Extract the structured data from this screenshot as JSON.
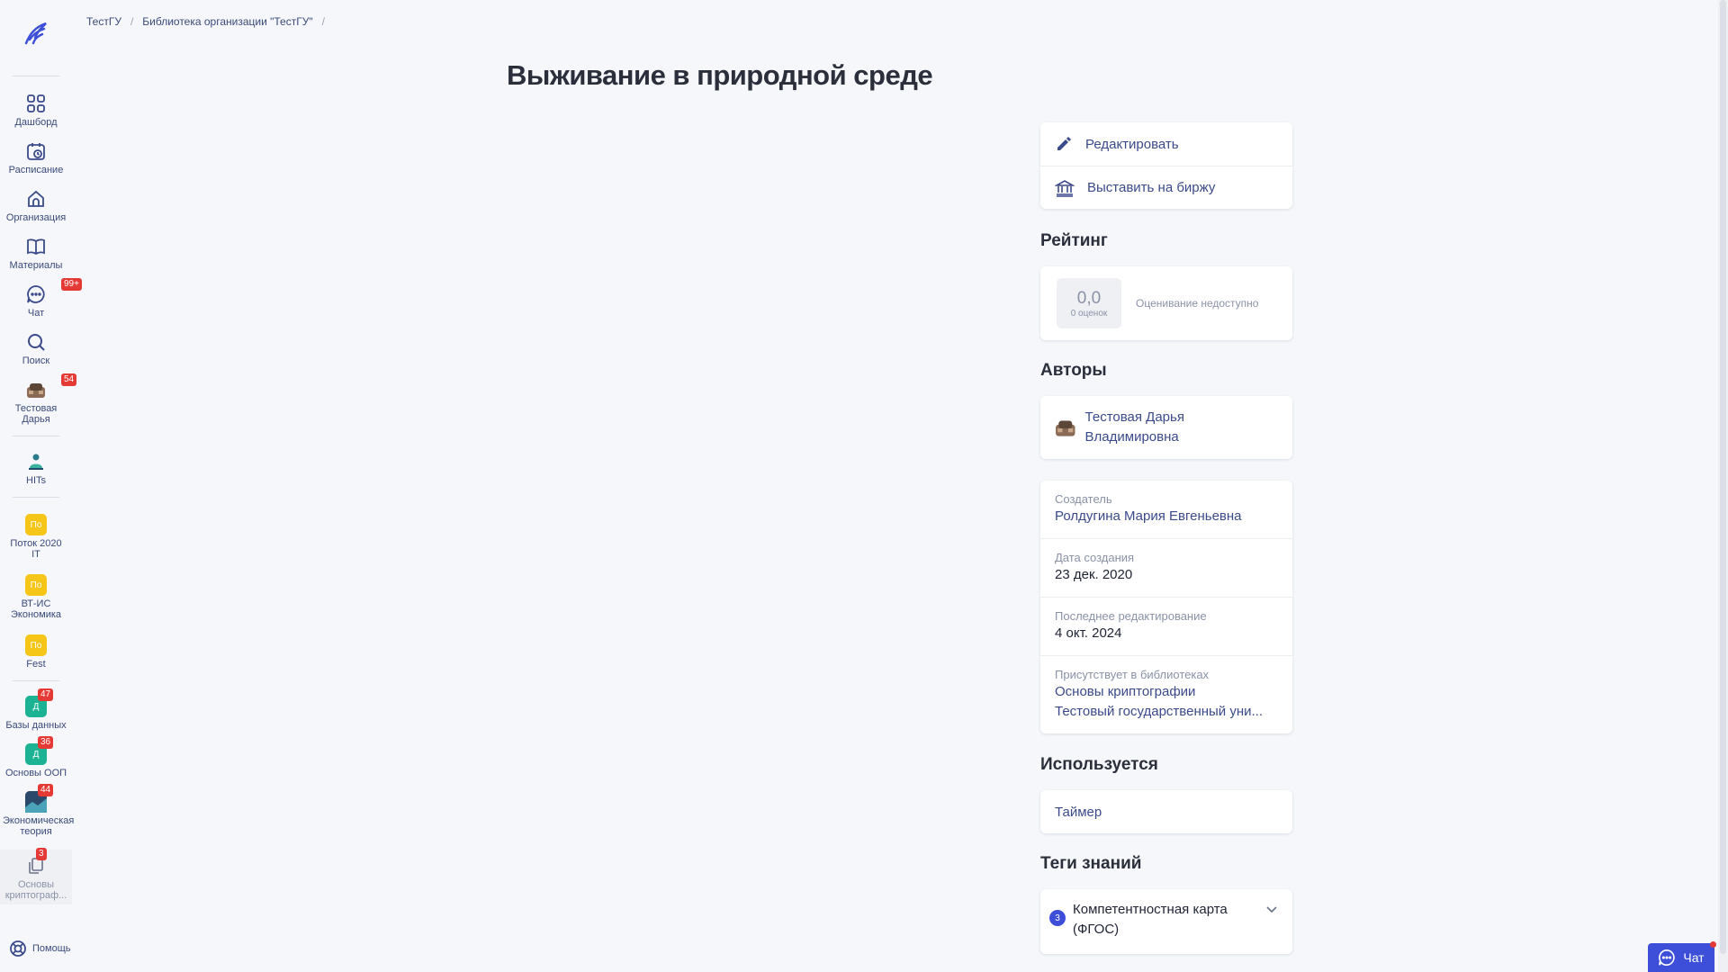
{
  "sidebar": {
    "items": [
      {
        "label": "Дашборд",
        "icon": "dashboard-icon"
      },
      {
        "label": "Расписание",
        "icon": "calendar-icon"
      },
      {
        "label": "Организация",
        "icon": "organization-icon"
      },
      {
        "label": "Материалы",
        "icon": "book-icon"
      },
      {
        "label": "Чат",
        "icon": "chat-icon",
        "badge": "99+"
      },
      {
        "label": "Поиск",
        "icon": "search-icon"
      },
      {
        "label": "Тестовая Дарья",
        "icon": "avatar",
        "badge": "54"
      }
    ],
    "hits": {
      "label": "HITs"
    },
    "streams": [
      {
        "abbr": "По",
        "label": "Поток 2020 IT"
      },
      {
        "abbr": "По",
        "label": "ВТ-ИС Экономика"
      },
      {
        "abbr": "По",
        "label": "Fest"
      }
    ],
    "courses": [
      {
        "abbr": "Д",
        "label": "Базы данных",
        "badge": "47"
      },
      {
        "abbr": "Д",
        "label": "Основы ООП",
        "badge": "36"
      },
      {
        "abbr": "",
        "label": "Экономическая теория",
        "badge": "44"
      },
      {
        "abbr": "",
        "label": "Основы криптограф...",
        "badge": "3"
      }
    ],
    "help_label": "Помощь"
  },
  "breadcrumb": [
    "ТестГУ",
    "Библиотека организации \"ТестГУ\""
  ],
  "title": "Выживание в природной среде",
  "actions": {
    "edit": "Редактировать",
    "exchange": "Выставить на биржу"
  },
  "rating": {
    "section": "Рейтинг",
    "value": "0,0",
    "count": "0 оценок",
    "note": "Оценивание недоступно"
  },
  "authors": {
    "section": "Авторы",
    "name": "Тестовая Дарья Владимировна"
  },
  "info": {
    "creator_label": "Создатель",
    "creator": "Ролдугина Мария Евгеньевна",
    "created_label": "Дата создания",
    "created": "23 дек. 2020",
    "edited_label": "Последнее редактирование",
    "edited": "4 окт. 2024",
    "libs_label": "Присутствует в библиотеках",
    "libs": [
      "Основы криптографии",
      "Тестовый государственный уни..."
    ]
  },
  "used": {
    "section": "Используется",
    "item": "Таймер"
  },
  "tags": {
    "section": "Теги знаний",
    "count": "3",
    "item": "Компетентностная карта (ФГОС)"
  },
  "chat_fab": "Чат",
  "colors": {
    "accent": "#3d4fd9",
    "badge": "#e53935",
    "yellow": "#f5c518",
    "teal": "#1bb394"
  }
}
